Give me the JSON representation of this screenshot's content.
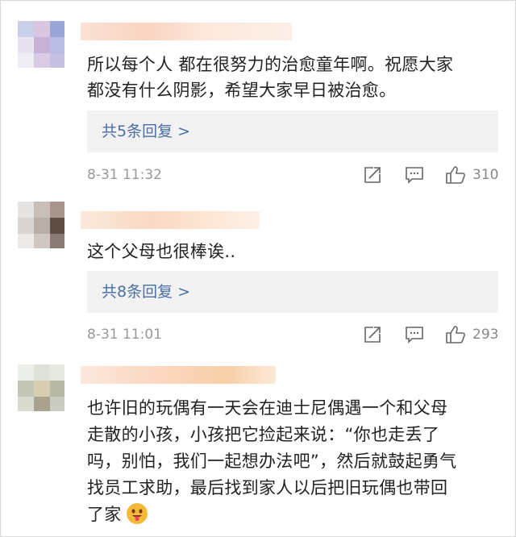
{
  "comments": [
    {
      "text_lines": [
        "所以每个人 都在很努力的治愈童年啊。祝愿大家",
        "都没有什么阴影，希望大家早日被治愈。"
      ],
      "replies": "共5条回复 >",
      "time": "8-31 11:32",
      "likes": "310"
    },
    {
      "text_lines": [
        "这个父母也很棒诶.."
      ],
      "replies": "共8条回复 >",
      "time": "8-31 11:01",
      "likes": "293"
    },
    {
      "text_lines": [
        "也许旧的玩偶有一天会在迪士尼偶遇一个和父母",
        "走散的小孩，小孩把它捡起来说：“你也走丢了",
        "吗，别怕，我们一起想办法吧”，然后就鼓起勇气",
        "找员工求助，最后找到家人以后把旧玩偶也带回",
        "了家"
      ]
    }
  ],
  "icons": {
    "share": "share-icon",
    "comment": "comment-icon",
    "like": "thumbs-up-icon",
    "emoji": "tongue-out-emoji-icon"
  },
  "colors": {
    "reply_link": "#4a6fa5",
    "reply_bg": "#f2f2f2",
    "meta_text": "#999999"
  }
}
